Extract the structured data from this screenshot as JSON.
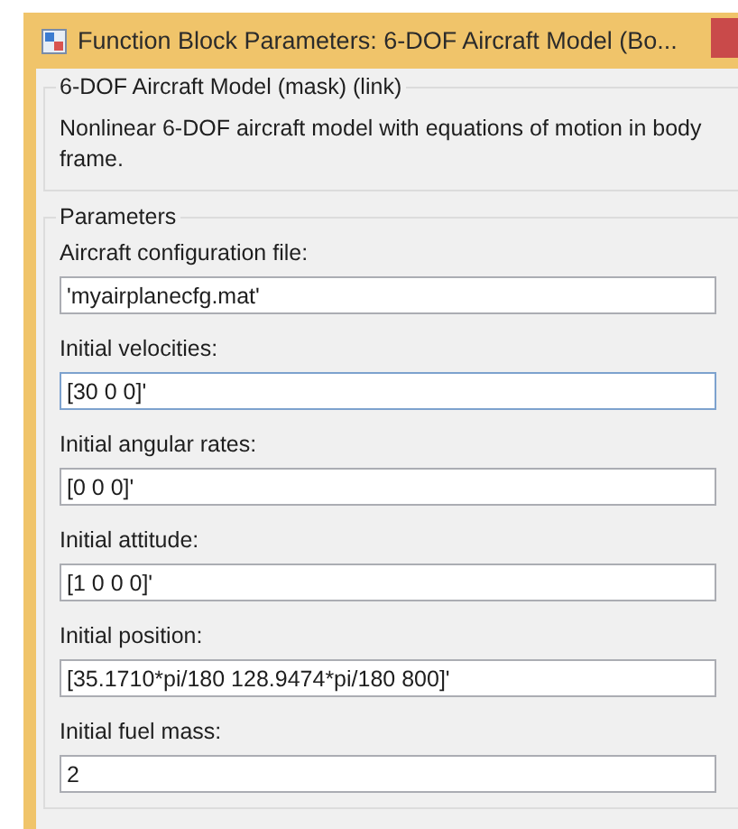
{
  "window": {
    "title": "Function Block Parameters: 6-DOF Aircraft Model (Bo..."
  },
  "mask_group": {
    "title": "6-DOF Aircraft Model (mask) (link)",
    "description": "Nonlinear 6-DOF aircraft model with equations of motion in body frame."
  },
  "parameters": {
    "title": "Parameters",
    "fields": [
      {
        "label": "Aircraft configuration file:",
        "value": "'myairplanecfg.mat'",
        "focused": false
      },
      {
        "label": "Initial velocities:",
        "value": "[30 0 0]'",
        "focused": true
      },
      {
        "label": "Initial angular rates:",
        "value": "[0 0 0]'",
        "focused": false
      },
      {
        "label": "Initial attitude:",
        "value": "[1 0 0 0]'",
        "focused": false
      },
      {
        "label": "Initial position:",
        "value": "[35.1710*pi/180 128.9474*pi/180 800]'",
        "focused": false
      },
      {
        "label": "Initial fuel mass:",
        "value": "2",
        "focused": false
      }
    ]
  }
}
